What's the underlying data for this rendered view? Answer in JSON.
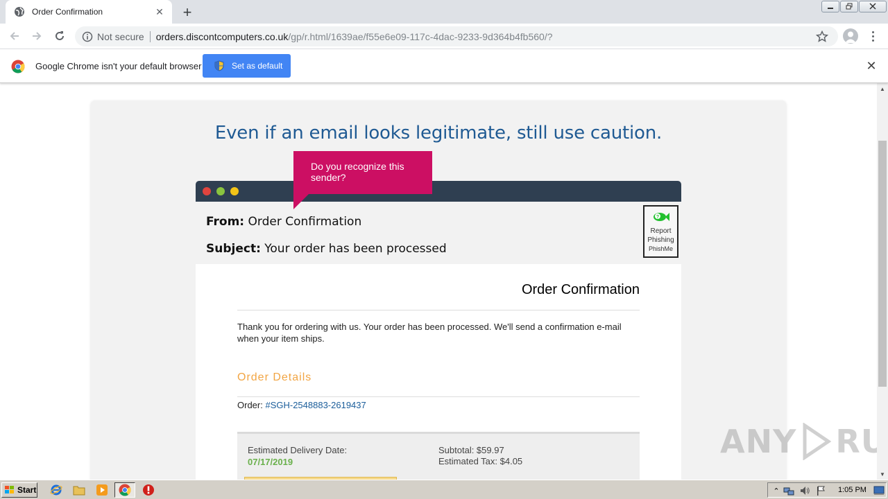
{
  "browser": {
    "tab_title": "Order Confirmation",
    "tab_close": "✕",
    "new_tab": "+",
    "security_label": "Not secure",
    "url_host": "orders.discontcomputers.co.uk",
    "url_path": "/gp/r.html/1639ae/f55e6e09-117c-4dac-9233-9d364b4fb560/?",
    "window_controls": [
      "minimize",
      "restore",
      "close"
    ]
  },
  "infobar": {
    "message": "Google Chrome isn't your default browser",
    "button_label": "Set as default",
    "close": "✕"
  },
  "page": {
    "headline": "Even if an email looks legitimate, still use caution.",
    "callout": "Do you recognize this sender?",
    "email": {
      "from_label": "From:",
      "from_value": "Order Confirmation",
      "subject_label": "Subject:",
      "subject_value": "Your order has been processed",
      "report_line1": "Report",
      "report_line2": "Phishing",
      "report_brand": "PhishMe"
    },
    "mail": {
      "title": "Order Confirmation",
      "thanks": "Thank you for ordering with us. Your order has been processed. We'll send a confirmation e-mail when your item ships.",
      "details_heading": "Order Details",
      "order_label": "Order:",
      "order_number": "#SGH-2548883-2619437",
      "delivery_label": "Estimated Delivery Date:",
      "delivery_date": "07/17/2019",
      "subtotal": "Subtotal: $59.97",
      "tax": "Estimated Tax: $4.05"
    },
    "watermark_left": "ANY",
    "watermark_right": "RUN"
  },
  "taskbar": {
    "start_label": "Start",
    "clock": "1:05 PM"
  },
  "colors": {
    "headline": "#1f5a93",
    "callout": "#cc0f63",
    "details_heading": "#f2a543",
    "delivery_date": "#6ab04c",
    "mock_titlebar": "#2f3f51",
    "button_blue": "#4285f4"
  }
}
